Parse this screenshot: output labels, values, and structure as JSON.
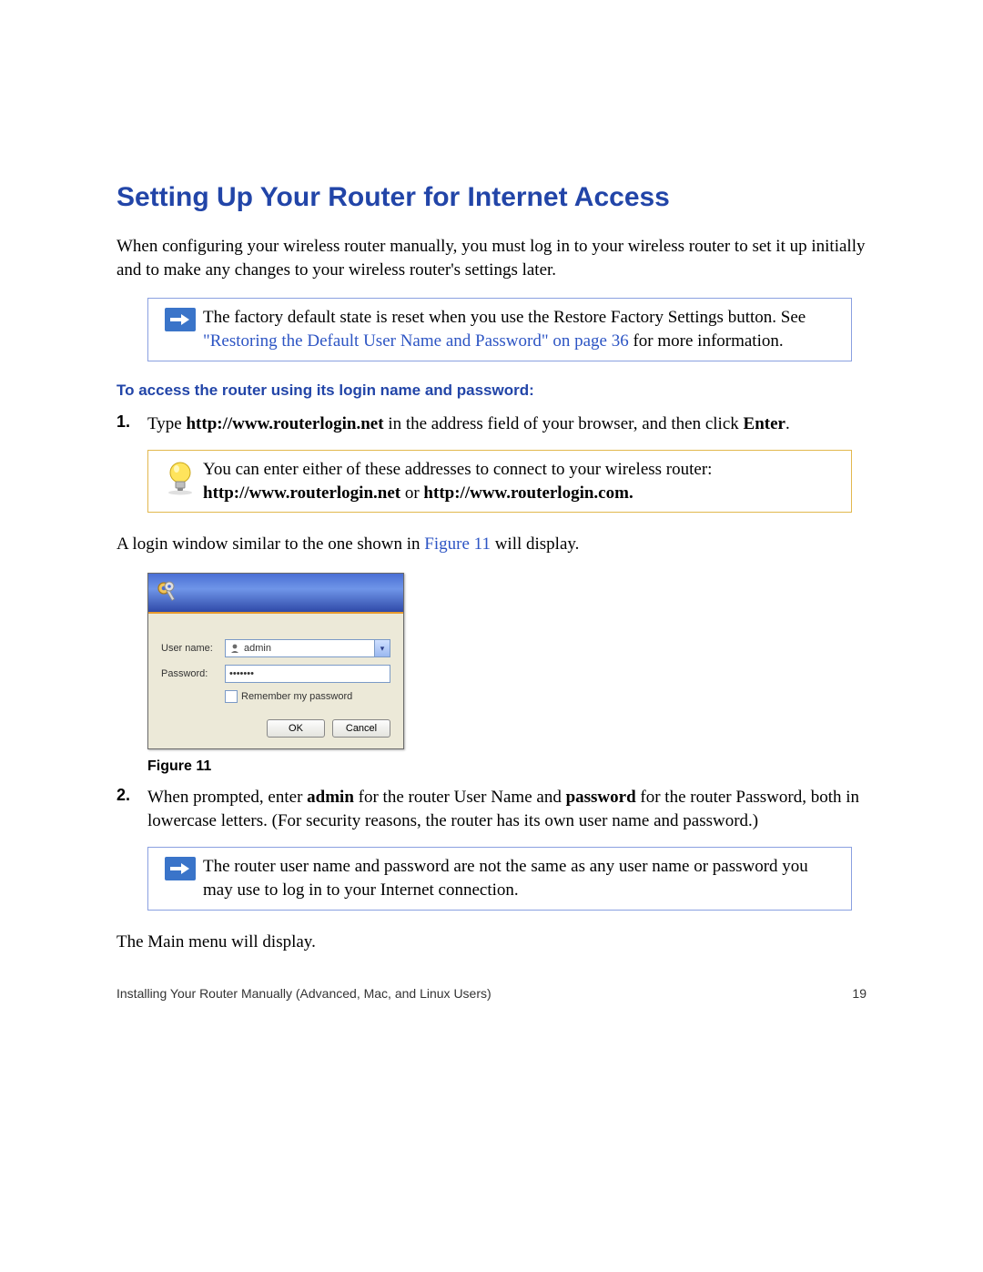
{
  "heading": "Setting Up Your Router for Internet Access",
  "intro": "When configuring your wireless router manually, you must log in to your wireless router to set it up initially and to make any changes to your wireless router's settings later.",
  "note1": {
    "pre": "The factory default state is reset when you use the Restore Factory Settings button. See ",
    "link": "\"Restoring the Default User Name and Password\" on page 36",
    "post": " for more information."
  },
  "subhead": "To access the router using its login name and password:",
  "step1": {
    "num": "1.",
    "pre": "Type ",
    "bold1": "http://www.routerlogin.net",
    "mid": " in the address field of your browser, and then click ",
    "bold2": "Enter",
    "post": "."
  },
  "tip": {
    "line1": "You can enter either of these addresses to connect to your wireless router:",
    "bold_a": "http://www.routerlogin.net",
    "sep": " or ",
    "bold_b": "http://www.routerlogin.com."
  },
  "afterTip": {
    "pre": "A login window similar to the one shown in ",
    "link": "Figure 11",
    "post": " will display."
  },
  "dialog": {
    "username_label": "User name:",
    "password_label": "Password:",
    "username_value": "admin",
    "password_value": "•••••••",
    "remember": "Remember my password",
    "ok": "OK",
    "cancel": "Cancel"
  },
  "figcaption": "Figure 11",
  "step2": {
    "num": "2.",
    "pre": "When prompted, enter ",
    "bold1": "admin",
    "mid1": " for the router User Name and ",
    "bold2": "password",
    "mid2": " for the router Password, both in lowercase letters. (For security reasons, the router has its own user name and password.)"
  },
  "note2": "The router user name and password are not the same as any user name or password you may use to log in to your Internet connection.",
  "afterNote2": "The Main menu will display.",
  "footer": {
    "left": "Installing Your Router Manually (Advanced, Mac, and Linux Users)",
    "right": "19"
  }
}
